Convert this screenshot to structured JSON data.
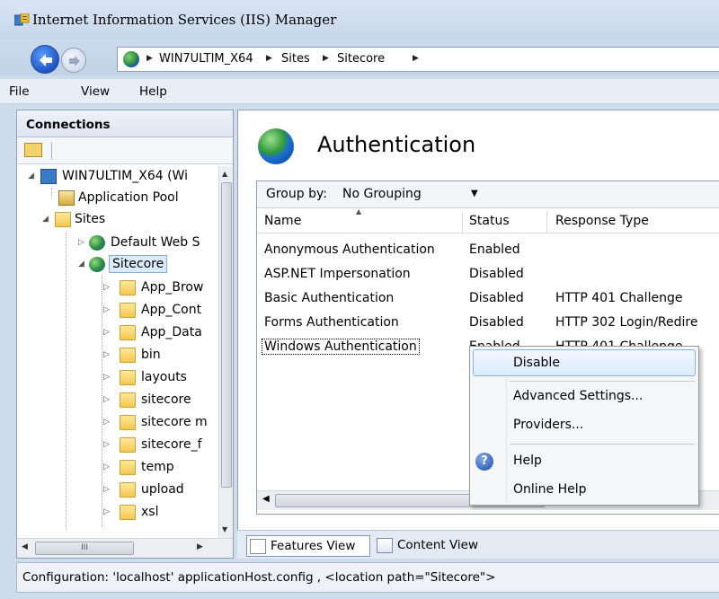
{
  "window": {
    "title": "Internet Information Services (IIS) Manager"
  },
  "address": {
    "crumbs": [
      "WIN7ULTIM_X64",
      "Sites",
      "Sitecore"
    ]
  },
  "menu": {
    "file": "File",
    "view": "View",
    "help": "Help"
  },
  "connections": {
    "header": "Connections",
    "tree": [
      {
        "label": "WIN7ULTIM_X64 (Wi",
        "icon": "server-icon"
      },
      {
        "label": "Application Pool",
        "icon": "app-pool-icon"
      },
      {
        "label": "Sites",
        "icon": "sites-folder-icon"
      },
      {
        "label": "Default Web S",
        "icon": "website-stopped-icon"
      },
      {
        "label": "Sitecore",
        "icon": "website-globe-icon"
      },
      {
        "label": "App_Brow",
        "icon": "folder-icon"
      },
      {
        "label": "App_Cont",
        "icon": "folder-icon"
      },
      {
        "label": "App_Data",
        "icon": "folder-icon"
      },
      {
        "label": "bin",
        "icon": "folder-icon"
      },
      {
        "label": "layouts",
        "icon": "folder-icon"
      },
      {
        "label": "sitecore",
        "icon": "folder-icon"
      },
      {
        "label": "sitecore m",
        "icon": "folder-icon"
      },
      {
        "label": "sitecore_f",
        "icon": "folder-icon"
      },
      {
        "label": "temp",
        "icon": "folder-icon"
      },
      {
        "label": "upload",
        "icon": "folder-icon"
      },
      {
        "label": "xsl",
        "icon": "folder-icon"
      }
    ]
  },
  "feature": {
    "title": "Authentication",
    "group_by_label": "Group by:",
    "group_by_value": "No Grouping",
    "columns": [
      "Name",
      "Status",
      "Response Type"
    ],
    "rows": [
      {
        "name": "Anonymous Authentication",
        "status": "Enabled",
        "response": ""
      },
      {
        "name": "ASP.NET Impersonation",
        "status": "Disabled",
        "response": ""
      },
      {
        "name": "Basic Authentication",
        "status": "Disabled",
        "response": "HTTP 401 Challenge"
      },
      {
        "name": "Forms Authentication",
        "status": "Disabled",
        "response": "HTTP 302 Login/Redire"
      },
      {
        "name": "Windows Authentication",
        "status": "Enabled",
        "response": "HTTP 401 Challenge"
      }
    ]
  },
  "context_menu": {
    "items": [
      "Disable",
      "Advanced Settings...",
      "Providers...",
      "Help",
      "Online Help"
    ]
  },
  "view_tabs": {
    "features": "Features View",
    "content": "Content View"
  },
  "status": {
    "text": "Configuration: 'localhost' applicationHost.config , <location path=\"Sitecore\">"
  }
}
